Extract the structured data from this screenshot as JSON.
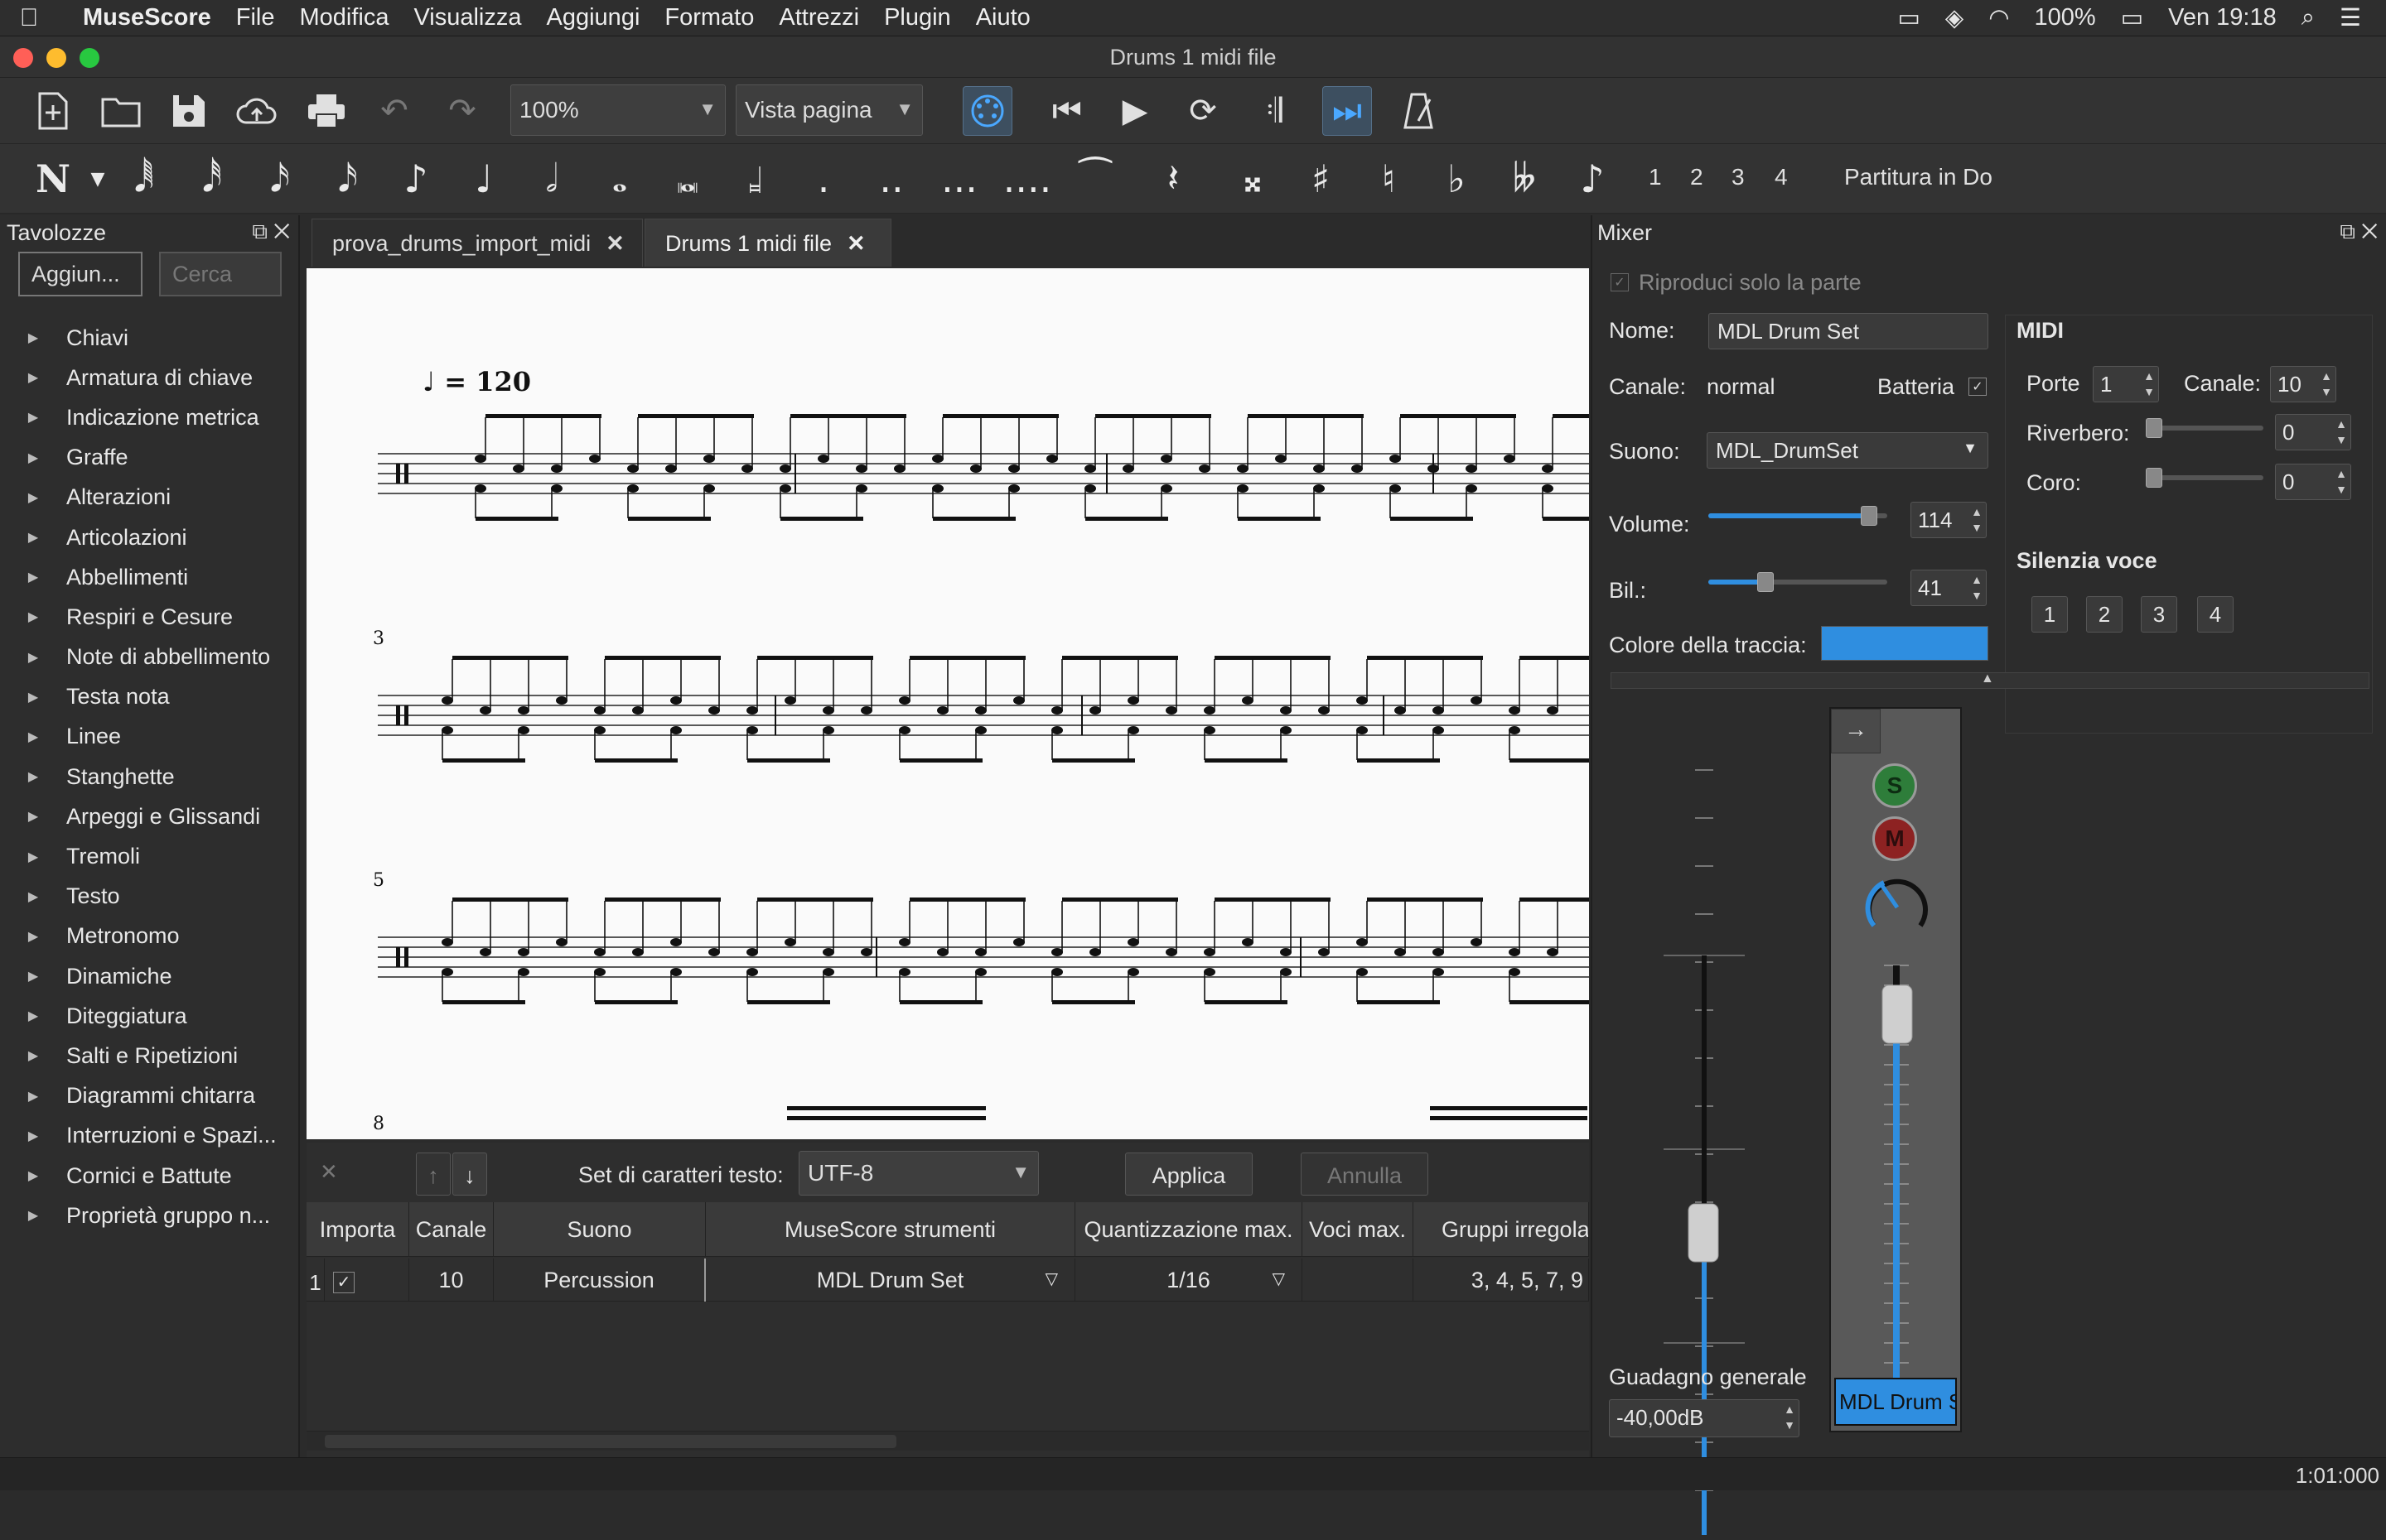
{
  "menubar": {
    "app": "MuseScore",
    "items": [
      "File",
      "Modifica",
      "Visualizza",
      "Aggiungi",
      "Formato",
      "Attrezzi",
      "Plugin",
      "Aiuto"
    ],
    "battery": "100%",
    "clock": "Ven 19:18"
  },
  "window": {
    "title": "Drums 1 midi file"
  },
  "toolbar": {
    "zoom": "100%",
    "view_mode": "Vista pagina"
  },
  "note_input": {
    "voices": [
      "1",
      "2",
      "3",
      "4"
    ],
    "concert_pitch": "Partitura in Do"
  },
  "palette": {
    "title": "Tavolozze",
    "add_button": "Aggiun...",
    "search_placeholder": "Cerca",
    "items": [
      "Chiavi",
      "Armatura di chiave",
      "Indicazione metrica",
      "Graffe",
      "Alterazioni",
      "Articolazioni",
      "Abbellimenti",
      "Respiri e Cesure",
      "Note di abbellimento",
      "Testa nota",
      "Linee",
      "Stanghette",
      "Arpeggi e Glissandi",
      "Tremoli",
      "Testo",
      "Metronomo",
      "Dinamiche",
      "Diteggiatura",
      "Salti e Ripetizioni",
      "Diagrammi chitarra",
      "Interruzioni e Spazi...",
      "Cornici e Battute",
      "Proprietà gruppo n..."
    ]
  },
  "tabs": [
    {
      "label": "prova_drums_import_midi"
    },
    {
      "label": "Drums 1 midi file"
    }
  ],
  "score": {
    "tempo": "♩ = 120",
    "measure_numbers": [
      "3",
      "5",
      "8"
    ]
  },
  "midi_import": {
    "charset_label": "Set di caratteri testo:",
    "charset_value": "UTF-8",
    "apply": "Applica",
    "cancel": "Annulla",
    "columns": [
      "Importa",
      "Canale",
      "Suono",
      "MuseScore strumenti",
      "Quantizzazione max.",
      "Voci max.",
      "Gruppi irregola"
    ],
    "rows": [
      {
        "index": "1",
        "import": "✓",
        "channel": "10",
        "sound": "Percussion",
        "instrument": "MDL Drum Set",
        "quantization": "1/16",
        "voices": "",
        "tuplets": "3, 4, 5, 7, 9"
      }
    ]
  },
  "mixer": {
    "title": "Mixer",
    "solo_part": "Riproduci solo la parte",
    "name_label": "Nome:",
    "name_value": "MDL Drum Set",
    "channel_label": "Canale:",
    "channel_value": "normal",
    "drum_label": "Batteria",
    "sound_label": "Suono:",
    "sound_value": "MDL_DrumSet",
    "volume_label": "Volume:",
    "volume_value": "114",
    "volume_level": 0.9,
    "pan_label": "Bil.:",
    "pan_value": "41",
    "pan_level": 0.32,
    "track_color_label": "Colore della traccia:",
    "track_color": "#2f8ee0",
    "midi": {
      "title": "MIDI",
      "port_label": "Porte",
      "port_value": "1",
      "channel_label": "Canale:",
      "channel_value": "10",
      "reverb_label": "Riverbero:",
      "reverb_value": "0",
      "chorus_label": "Coro:",
      "chorus_value": "0"
    },
    "mute_voice": {
      "title": "Silenzia voce",
      "voices": [
        "1",
        "2",
        "3",
        "4"
      ]
    },
    "master_gain_label": "Guadagno generale",
    "master_gain_value": "-40,00dB",
    "strip_solo": "S",
    "strip_mute": "M",
    "strip_name": "MDL Drum S"
  },
  "status": {
    "time": "1:01:000"
  }
}
